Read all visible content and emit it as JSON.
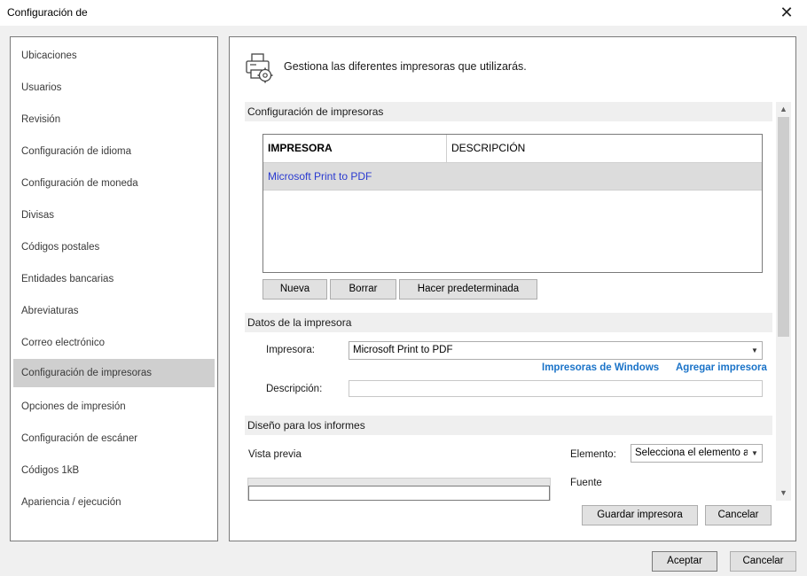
{
  "window": {
    "title": "Configuración de",
    "close_glyph": "✕"
  },
  "sidebar": {
    "items": [
      {
        "label": "Ubicaciones"
      },
      {
        "label": "Usuarios"
      },
      {
        "label": "Revisión"
      },
      {
        "label": "Configuración de idioma"
      },
      {
        "label": "Configuración de moneda"
      },
      {
        "label": "Divisas"
      },
      {
        "label": "Códigos postales"
      },
      {
        "label": "Entidades bancarias"
      },
      {
        "label": "Abreviaturas"
      },
      {
        "label": "Correo electrónico"
      },
      {
        "label": "Configuración de impresoras",
        "selected": true
      },
      {
        "label": "Opciones de impresión"
      },
      {
        "label": "Configuración de escáner"
      },
      {
        "label": "Códigos 1kB"
      },
      {
        "label": "Apariencia / ejecución"
      }
    ]
  },
  "panel": {
    "header_icon": "printer-gear-icon",
    "header_text": "Gestiona las diferentes impresoras que utilizarás.",
    "printers_section": {
      "title": "Configuración de impresoras",
      "columns": [
        "IMPRESORA",
        "DESCRIPCIÓN"
      ],
      "rows": [
        {
          "printer": "Microsoft Print to PDF",
          "description": ""
        }
      ],
      "buttons": {
        "new": "Nueva",
        "delete": "Borrar",
        "set_default": "Hacer predeterminada"
      }
    },
    "printer_data_section": {
      "title": "Datos de la impresora",
      "printer_label": "Impresora:",
      "printer_value": "Microsoft Print to PDF",
      "windows_printers_link": "Impresoras de Windows",
      "add_printer_link": "Agregar impresora",
      "description_label": "Descripción:",
      "description_value": ""
    },
    "report_design_section": {
      "title": "Diseño para los informes",
      "preview_label": "Vista previa",
      "element_label": "Elemento:",
      "element_value": "Selecciona el elemento a",
      "font_label": "Fuente"
    },
    "buttons": {
      "save_printer": "Guardar impresora",
      "cancel": "Cancelar"
    }
  },
  "footer": {
    "accept": "Aceptar",
    "cancel": "Cancelar"
  },
  "colors": {
    "link": "#1a73c8",
    "row_text": "#2a3ad0",
    "selected_bg": "#cfcfcf"
  }
}
